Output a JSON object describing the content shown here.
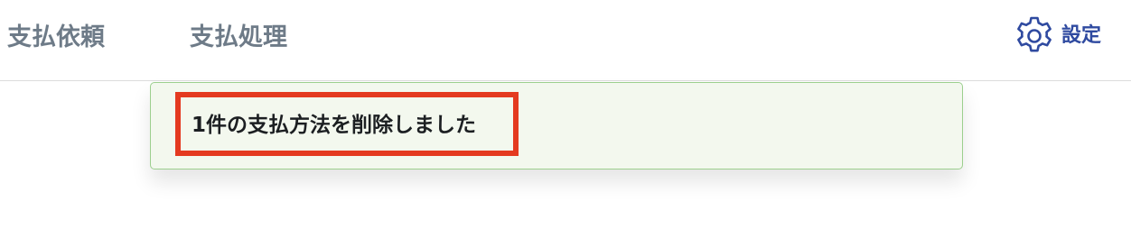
{
  "header": {
    "nav": {
      "payment_request": "支払依頼",
      "payment_processing": "支払処理"
    },
    "settings": {
      "label": "設定",
      "icon": "gear-icon"
    }
  },
  "notification": {
    "message": "1件の支払方法を削除しました",
    "highlight_color": "#e43a20",
    "background": "#f3f8ee"
  }
}
